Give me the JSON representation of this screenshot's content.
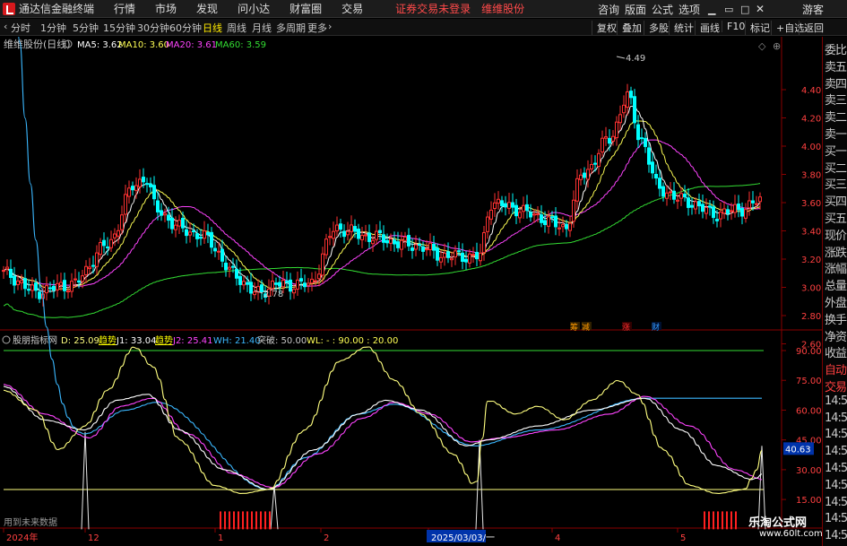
{
  "app": {
    "title": "通达信金融终端"
  },
  "menu": {
    "items": [
      "行情",
      "市场",
      "发现",
      "问小达",
      "财富圈",
      "交易"
    ],
    "alert": "证券交易未登录",
    "stock_link": "维维股份",
    "right": [
      "咨询",
      "版面",
      "公式",
      "选项"
    ],
    "guest": "游客"
  },
  "toolbar": {
    "periods": [
      "分时",
      "1分钟",
      "5分钟",
      "15分钟",
      "30分钟",
      "60分钟",
      "日线",
      "周线",
      "月线",
      "多周期",
      "更多"
    ],
    "active": "日线",
    "right": [
      "复权",
      "叠加",
      "多股",
      "统计",
      "画线",
      "F10",
      "标记",
      "+自选",
      "返回"
    ]
  },
  "price_panel": {
    "stock_title": "维维股份(日线)",
    "ma": [
      {
        "label": "MA5:",
        "value": "3.62",
        "color": "#ffffff"
      },
      {
        "label": "MA10:",
        "value": "3.60",
        "color": "#ffff55"
      },
      {
        "label": "MA20:",
        "value": "3.61",
        "color": "#ff44ff"
      },
      {
        "label": "MA60:",
        "value": "3.59",
        "color": "#33dd33"
      }
    ],
    "high_label": "4.49",
    "low_label": "2.78",
    "y_ticks": [
      "4.40",
      "4.20",
      "4.00",
      "3.80",
      "3.60",
      "3.40",
      "3.20",
      "3.00",
      "2.80",
      "2.60"
    ],
    "markers": [
      {
        "text": "筹",
        "color": "#ff9900"
      },
      {
        "text": "减",
        "color": "#ff9900"
      },
      {
        "text": "涨",
        "color": "#ff3030"
      },
      {
        "text": "财",
        "color": "#3399ff"
      }
    ]
  },
  "indicator_panel": {
    "name": "股朋指标网",
    "d": "D: 25.09",
    "j1_label": "趋势",
    "j1": "J1: 33.04",
    "j2_label": "趋势",
    "j2": "J2: 25.41",
    "wh": "WH: 21.40",
    "breakout": "突破: 50.00",
    "wl": "WL: - : 90.00 : 20.00",
    "y_ticks": [
      "90.00",
      "75.00",
      "60.00",
      "45.00",
      "30.00",
      "15.00"
    ],
    "current": "40.63",
    "watermark": "用到未来数据"
  },
  "xaxis": {
    "labels": [
      "2024年",
      "12",
      "1",
      "2",
      "2025/03/03/一",
      "4",
      "5"
    ]
  },
  "right_panel": [
    "委比",
    "卖五",
    "卖四",
    "卖三",
    "卖二",
    "卖一",
    "买一",
    "买二",
    "买三",
    "买四",
    "买五",
    "现价",
    "涨跌",
    "涨幅",
    "总量",
    "外盘",
    "换手",
    "净资",
    "收益",
    "自动",
    "交易",
    "14:5",
    "14:5",
    "14:5",
    "14:5",
    "14:5",
    "14:5",
    "14:5",
    "14:5",
    "14:5"
  ],
  "brand": {
    "line1": "乐淘公式网",
    "line2": "www.60lt.com"
  },
  "colors": {
    "up": "#ff3232",
    "down": "#00ffff",
    "ma5": "#ffffff",
    "ma10": "#ffff55",
    "ma20": "#ff44ff",
    "ma60": "#33dd33",
    "line_d": "#ffff80",
    "line_j1": "#ffffff",
    "line_j2": "#ff44ff",
    "line_wh": "#3bb8ff"
  }
}
